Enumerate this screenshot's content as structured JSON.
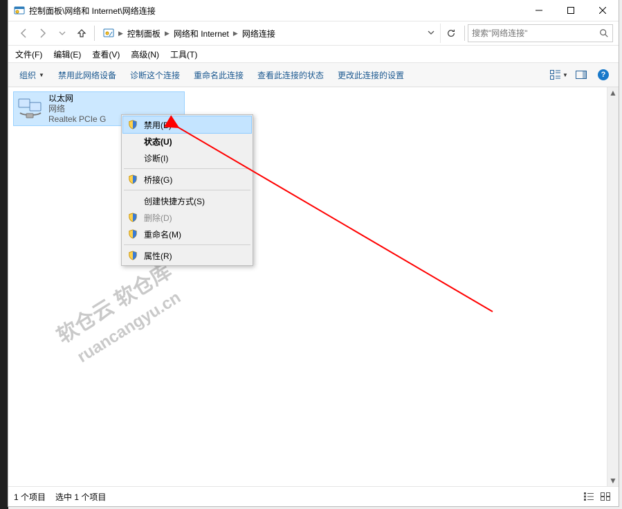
{
  "window_title": "控制面板\\网络和 Internet\\网络连接",
  "breadcrumb": [
    "控制面板",
    "网络和 Internet",
    "网络连接"
  ],
  "search_placeholder": "搜索\"网络连接\"",
  "menubar": [
    "文件(F)",
    "编辑(E)",
    "查看(V)",
    "高级(N)",
    "工具(T)"
  ],
  "cmdbar": {
    "organize": "组织",
    "items": [
      "禁用此网络设备",
      "诊断这个连接",
      "重命名此连接",
      "查看此连接的状态",
      "更改此连接的设置"
    ]
  },
  "connection": {
    "name": "以太网",
    "status": "网络",
    "adapter": "Realtek PCIe G"
  },
  "context_menu": [
    {
      "label": "禁用(B)",
      "shield": true,
      "state": "hover"
    },
    {
      "label": "状态(U)",
      "shield": false,
      "state": "default"
    },
    {
      "label": "诊断(I)",
      "shield": false,
      "state": ""
    },
    {
      "sep": true
    },
    {
      "label": "桥接(G)",
      "shield": true,
      "state": ""
    },
    {
      "sep": true
    },
    {
      "label": "创建快捷方式(S)",
      "shield": false,
      "state": ""
    },
    {
      "label": "删除(D)",
      "shield": true,
      "state": "disabled"
    },
    {
      "label": "重命名(M)",
      "shield": true,
      "state": ""
    },
    {
      "sep": true
    },
    {
      "label": "属性(R)",
      "shield": true,
      "state": ""
    }
  ],
  "statusbar": {
    "count": "1 个项目",
    "selected": "选中 1 个项目"
  },
  "watermark": {
    "line1": "软仓云 软仓库",
    "line2": "ruancangyu.cn"
  }
}
